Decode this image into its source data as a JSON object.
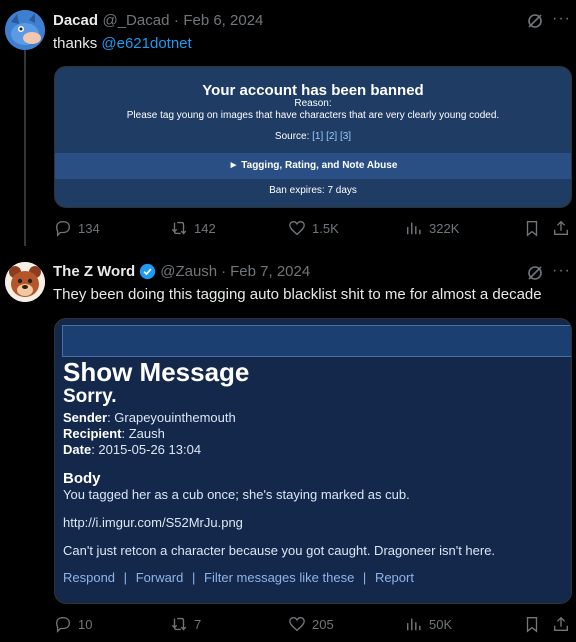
{
  "tweet1": {
    "display_name": "Dacad",
    "handle": "@_Dacad",
    "date": "Feb 6, 2024",
    "dot": "·",
    "text_prefix": "thanks ",
    "mention": "@e621dotnet",
    "embed": {
      "title": "Your account has been banned",
      "reason_label": "Reason:",
      "reason_text": "Please tag young on images that have characters that are very clearly young coded.",
      "source_label": "Source:",
      "source_links": [
        "[1]",
        "[2]",
        "[3]"
      ],
      "section": "► Tagging, Rating, and Note Abuse",
      "expires": "Ban expires: 7 days"
    },
    "actions": {
      "replies": "134",
      "reposts": "142",
      "likes": "1.5K",
      "views": "322K"
    }
  },
  "tweet2": {
    "display_name": "The Z Word",
    "handle": "@Zaush",
    "date": "Feb 7, 2024",
    "dot": "·",
    "text": "They been doing this tagging auto blacklist shit to me for almost a decade",
    "embed": {
      "heading": "Show Message",
      "subject": "Sorry.",
      "sender_label": "Sender",
      "sender": ": Grapeyouinthemouth",
      "recipient_label": "Recipient",
      "recipient": ": Zaush",
      "date_label": "Date",
      "date": ": 2015-05-26 13:04",
      "body_label": "Body",
      "line1": "You tagged her as a cub once; she's staying marked as cub.",
      "line2": "http://i.imgur.com/S52MrJu.png",
      "line3": "Can't just retcon a character because you got caught. Dragoneer isn't here.",
      "footer_links": [
        "Respond",
        "Forward",
        "Filter messages like these",
        "Report"
      ],
      "footer_sep": "|"
    },
    "actions": {
      "replies": "10",
      "reposts": "7",
      "likes": "205",
      "views": "50K"
    }
  },
  "colors": {
    "accent": "#1d9bf0",
    "verified": "#1d9bf0",
    "muted": "#71767b"
  }
}
